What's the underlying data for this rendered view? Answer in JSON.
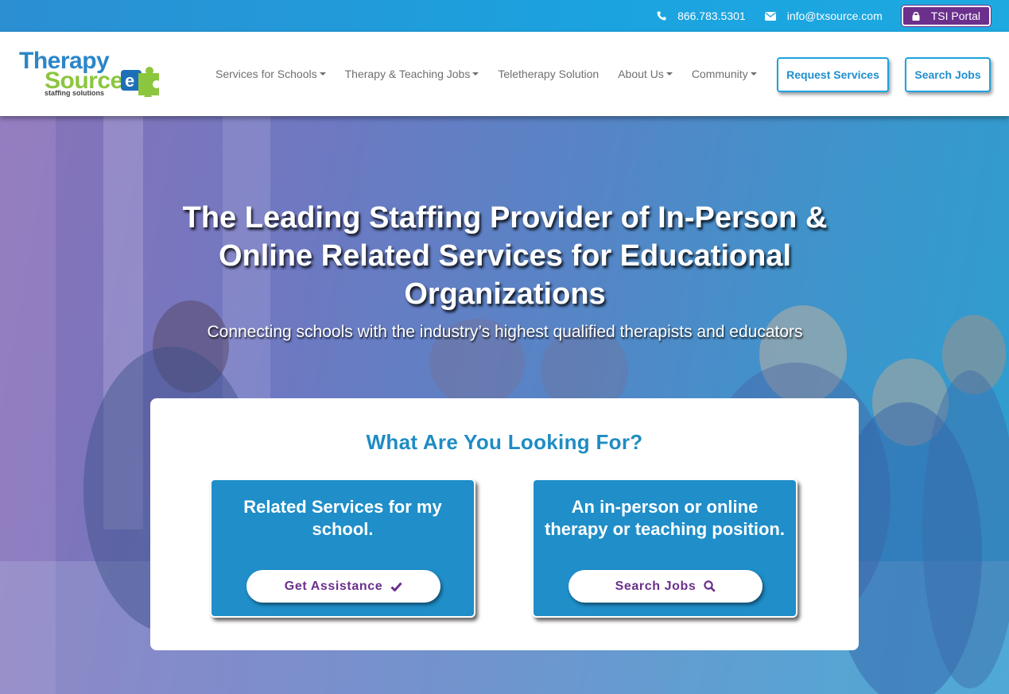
{
  "topbar": {
    "phone": "866.783.5301",
    "email": "info@txsource.com",
    "portal_label": "TSI Portal",
    "icons": [
      "phone-icon",
      "envelope-icon",
      "lock-icon"
    ]
  },
  "logo": {
    "line1": "Therapy",
    "line2": "Source",
    "tagline": "staffing solutions"
  },
  "nav": {
    "items": [
      {
        "label": "Services for Schools",
        "dropdown": true
      },
      {
        "label": "Therapy & Teaching Jobs",
        "dropdown": true
      },
      {
        "label": "Teletherapy Solution",
        "dropdown": false
      },
      {
        "label": "About Us",
        "dropdown": true
      },
      {
        "label": "Community",
        "dropdown": true
      }
    ],
    "request_label": "Request Services",
    "search_label": "Search Jobs"
  },
  "hero": {
    "title": "The Leading Staffing Provider of In-Person & Online Related Services for Educational Organizations",
    "subtitle": "Connecting schools with the industry’s highest qualified therapists and educators"
  },
  "panel": {
    "heading": "What Are You Looking For?",
    "cards": [
      {
        "text": "Related Services for my school.",
        "button": "Get Assistance",
        "icon": "check-icon"
      },
      {
        "text": "An in-person or online therapy or teaching position.",
        "button": "Search Jobs",
        "icon": "search-icon"
      }
    ]
  },
  "colors": {
    "brand_blue": "#1ba3df",
    "brand_purple": "#6b2f8c",
    "brand_green": "#8cc63f",
    "card_blue": "#1f8ec9"
  }
}
